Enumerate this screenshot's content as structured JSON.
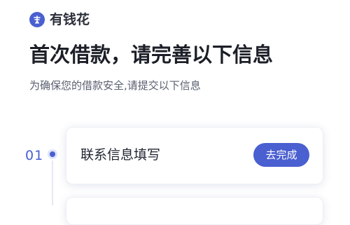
{
  "brand": {
    "name": "有钱花",
    "logo_icon": "coin-logo-icon"
  },
  "header": {
    "title": "首次借款，请完善以下信息",
    "subtitle": "为确保您的借款安全,请提交以下信息"
  },
  "steps": [
    {
      "number": "01",
      "label": "联系信息填写",
      "action_label": "去完成"
    }
  ],
  "colors": {
    "accent": "#4a5fd0",
    "title": "#1c1f27",
    "subtitle": "#5a6070"
  }
}
